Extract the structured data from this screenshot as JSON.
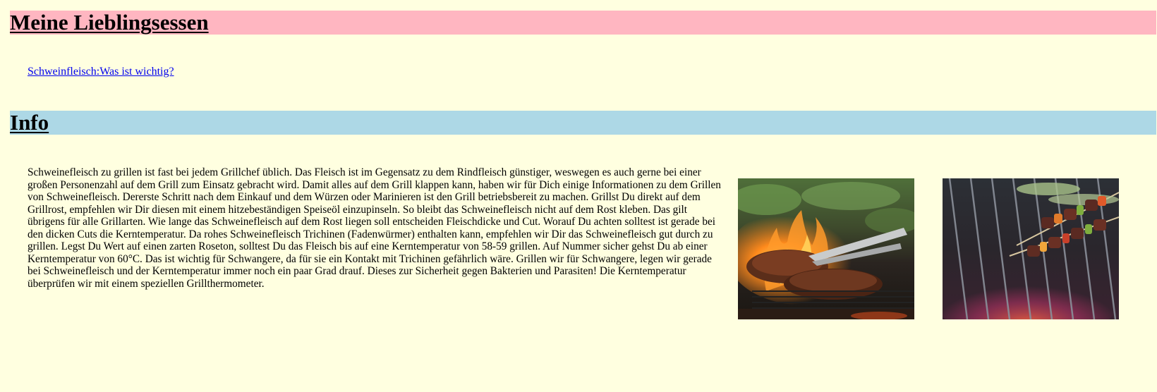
{
  "page": {
    "title": "Meine Lieblingsessen",
    "link_label": "Schweinfleisch:Was ist wichtig?",
    "info_heading": "Info",
    "paragraph": "Schweinefleisch zu grillen ist fast bei jedem Grillchef üblich. Das Fleisch ist im Gegensatz zu dem Rindfleisch günstiger, weswegen es auch gerne bei einer großen Personenzahl auf dem Grill zum Einsatz gebracht wird. Damit alles auf dem Grill klappen kann, haben wir für Dich einige Informationen zu dem Grillen von Schweinefleisch. Dererste Schritt nach dem Einkauf und dem Würzen oder Marinieren ist den Grill betriebsbereit zu machen. Grillst Du direkt auf dem Grillrost, empfehlen wir Dir diesen mit einem hitzebeständigen Speiseöl einzupinseln. So bleibt das Schweinefleisch nicht auf dem Rost kleben. Das gilt übrigens für alle Grillarten. Wie lange das Schweinefleisch auf dem Rost liegen soll entscheiden Fleischdicke und Cut. Worauf Du achten solltest ist gerade bei den dicken Cuts die Kerntemperatur. Da rohes Schweinefleisch Trichinen (Fadenwürmer) enthalten kann, empfehlen wir Dir das Schweinefleisch gut durch zu grillen. Legst Du Wert auf einen zarten Roseton, solltest Du das Fleisch bis auf eine Kerntemperatur von 58-59 grillen. Auf Nummer sicher gehst Du ab einer Kerntemperatur von 60°C. Das ist wichtig für Schwangere, da für sie ein Kontakt mit Trichinen gefährlich wäre. Grillen wir für Schwangere, legen wir gerade bei Schweinefleisch und der Kerntemperatur immer noch ein paar Grad drauf. Dieses zur Sicherheit gegen Bakterien und Parasiten! Die Kerntemperatur überprüfen wir mit einem speziellen Grillthermometer."
  },
  "colors": {
    "background": "#ffffe0",
    "title_bar": "#ffb6c1",
    "info_bar": "#add8e6",
    "link": "#0000ee"
  },
  "images": [
    {
      "icon": "grilled-steak-with-tongs-photo"
    },
    {
      "icon": "meat-skewers-on-grill-photo"
    }
  ]
}
